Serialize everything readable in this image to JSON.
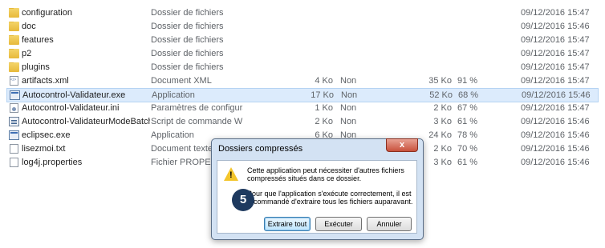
{
  "files": [
    {
      "name": "configuration",
      "type": "Dossier de fichiers",
      "size": "",
      "compressed": "",
      "packed": "",
      "ratio": "",
      "date": "09/12/2016 15:47",
      "icon": "folder-icon"
    },
    {
      "name": "doc",
      "type": "Dossier de fichiers",
      "size": "",
      "compressed": "",
      "packed": "",
      "ratio": "",
      "date": "09/12/2016 15:46",
      "icon": "folder-icon"
    },
    {
      "name": "features",
      "type": "Dossier de fichiers",
      "size": "",
      "compressed": "",
      "packed": "",
      "ratio": "",
      "date": "09/12/2016 15:47",
      "icon": "folder-icon"
    },
    {
      "name": "p2",
      "type": "Dossier de fichiers",
      "size": "",
      "compressed": "",
      "packed": "",
      "ratio": "",
      "date": "09/12/2016 15:47",
      "icon": "folder-icon"
    },
    {
      "name": "plugins",
      "type": "Dossier de fichiers",
      "size": "",
      "compressed": "",
      "packed": "",
      "ratio": "",
      "date": "09/12/2016 15:47",
      "icon": "folder-icon"
    },
    {
      "name": "artifacts.xml",
      "type": "Document XML",
      "size": "4 Ko",
      "compressed": "Non",
      "packed": "35 Ko",
      "ratio": "91 %",
      "date": "09/12/2016 15:47",
      "icon": "xml-file-icon"
    },
    {
      "name": "Autocontrol-Validateur.exe",
      "type": "Application",
      "size": "17 Ko",
      "compressed": "Non",
      "packed": "52 Ko",
      "ratio": "68 %",
      "date": "09/12/2016 15:46",
      "icon": "exe-icon"
    },
    {
      "name": "Autocontrol-Validateur.ini",
      "type": "Paramètres de configurati...",
      "size": "1 Ko",
      "compressed": "Non",
      "packed": "2 Ko",
      "ratio": "67 %",
      "date": "09/12/2016 15:47",
      "icon": "ini-file-icon"
    },
    {
      "name": "Autocontrol-ValidateurModeBatch...",
      "type": "Script de commande Win...",
      "size": "2 Ko",
      "compressed": "Non",
      "packed": "3 Ko",
      "ratio": "61 %",
      "date": "09/12/2016 15:46",
      "icon": "batch-file-icon"
    },
    {
      "name": "eclipsec.exe",
      "type": "Application",
      "size": "6 Ko",
      "compressed": "Non",
      "packed": "24 Ko",
      "ratio": "78 %",
      "date": "09/12/2016 15:46",
      "icon": "exe-icon"
    },
    {
      "name": "lisezmoi.txt",
      "type": "Document texte",
      "size": "",
      "compressed": "",
      "packed": "2 Ko",
      "ratio": "70 %",
      "date": "09/12/2016 15:46",
      "icon": "text-file-icon"
    },
    {
      "name": "log4j.properties",
      "type": "Fichier PROPERTIES",
      "size": "",
      "compressed": "",
      "packed": "3 Ko",
      "ratio": "61 %",
      "date": "09/12/2016 15:46",
      "icon": "file-icon"
    }
  ],
  "selected_index": 6,
  "dialog": {
    "title": "Dossiers compressés",
    "close": "x",
    "message1": "Cette application peut nécessiter d'autres fichiers compressés situés dans ce dossier.",
    "message2": "Pour que l'application s'exécute correctement, il est recommandé d'extraire tous les fichiers auparavant.",
    "buttons": {
      "extract": "Extraire tout",
      "run": "Exécuter",
      "cancel": "Annuler"
    },
    "warning_mark": "!"
  },
  "step_badge": "5"
}
